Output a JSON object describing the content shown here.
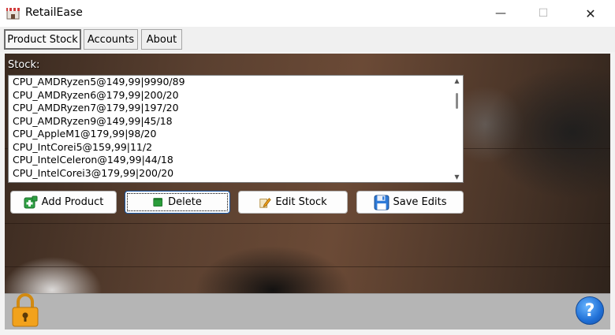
{
  "window": {
    "title": "RetailEase",
    "minimize_glyph": "—",
    "maximize_glyph": "☐",
    "close_glyph": "✕"
  },
  "tabs": [
    {
      "label": "Product Stock",
      "active": true
    },
    {
      "label": "Accounts",
      "active": false
    },
    {
      "label": "About",
      "active": false
    }
  ],
  "stock": {
    "label": "Stock:",
    "items": [
      "CPU_AMDRyzen5@149,99|9990/89",
      "CPU_AMDRyzen6@179,99|200/20",
      "CPU_AMDRyzen7@179,99|197/20",
      "CPU_AMDRyzen9@149,99|45/18",
      "CPU_AppleM1@179,99|98/20",
      "CPU_IntCorei5@159,99|11/2",
      "CPU_IntelCeleron@149,99|44/18",
      "CPU_IntelCorei3@179,99|200/20"
    ]
  },
  "buttons": {
    "add": {
      "label": "Add Product",
      "icon": "add-product-icon"
    },
    "delete": {
      "label": "Delete",
      "icon": "delete-icon"
    },
    "edit": {
      "label": "Edit Stock",
      "icon": "edit-icon"
    },
    "save": {
      "label": "Save Edits",
      "icon": "save-icon"
    }
  },
  "footer": {
    "lock_icon": "lock-icon",
    "help_label": "?"
  },
  "colors": {
    "accent": "#1f6fd6",
    "lock": "#f2a21c",
    "add_green": "#2ea043"
  }
}
